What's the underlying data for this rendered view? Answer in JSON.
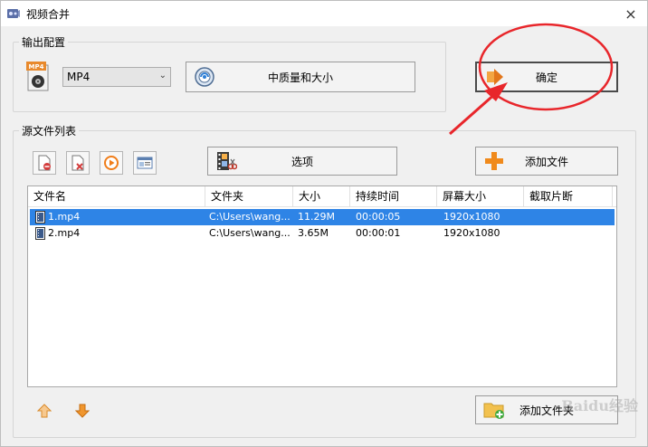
{
  "window": {
    "title": "视频合并",
    "close_glyph": "×"
  },
  "output_config": {
    "group_label": "输出配置",
    "format_icon_label": "MP4",
    "format_select_value": "MP4",
    "quality_button_label": "中质量和大小",
    "confirm_button_label": "确定"
  },
  "source_list": {
    "group_label": "源文件列表",
    "options_button_label": "选项",
    "add_file_button_label": "添加文件",
    "add_folder_button_label": "添加文件夹",
    "columns": [
      "文件名",
      "文件夹",
      "大小",
      "持续时间",
      "屏幕大小",
      "截取片断"
    ],
    "rows": [
      {
        "name": "1.mp4",
        "folder": "C:\\Users\\wang...",
        "size": "11.29M",
        "duration": "00:00:05",
        "resolution": "1920x1080",
        "clip": "",
        "selected": true
      },
      {
        "name": "2.mp4",
        "folder": "C:\\Users\\wang...",
        "size": "3.65M",
        "duration": "00:00:01",
        "resolution": "1920x1080",
        "clip": "",
        "selected": false
      }
    ]
  },
  "colors": {
    "selection": "#2e84e6",
    "annotation_red": "#e8262b",
    "window_bg": "#f0f0f0"
  },
  "watermark": {
    "text": "Baidu经验"
  }
}
